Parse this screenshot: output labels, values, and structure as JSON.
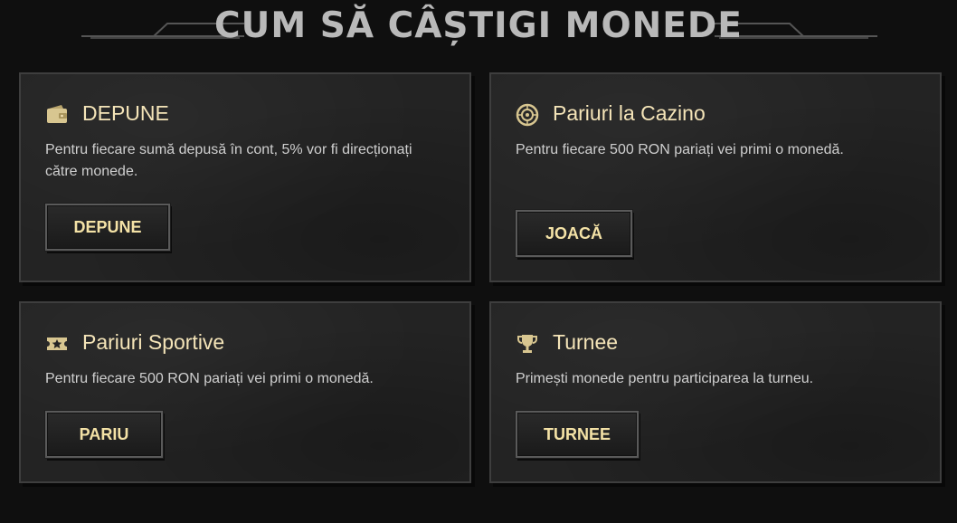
{
  "header": {
    "title": "CUM SĂ CÂȘTIGI MONEDE"
  },
  "cards": [
    {
      "icon": "wallet-icon",
      "title": "DEPUNE",
      "text": "Pentru fiecare sumă depusă în cont, 5% vor fi direcționați către monede.",
      "button": "DEPUNE"
    },
    {
      "icon": "roulette-icon",
      "title": "Pariuri la Cazino",
      "text": "Pentru fiecare 500 RON pariați vei primi o monedă.",
      "button": "JOACĂ"
    },
    {
      "icon": "ticket-star-icon",
      "title": "Pariuri Sportive",
      "text": "Pentru fiecare 500 RON pariați vei primi o monedă.",
      "button": "PARIU"
    },
    {
      "icon": "trophy-icon",
      "title": "Turnee",
      "text": "Primești monede pentru participarea la turneu.",
      "button": "TURNEE"
    }
  ],
  "colors": {
    "background": "#0f0f0f",
    "card": "#232323",
    "accent_gold": "#f4e2a6",
    "title_gray": "#b9b9b9"
  }
}
